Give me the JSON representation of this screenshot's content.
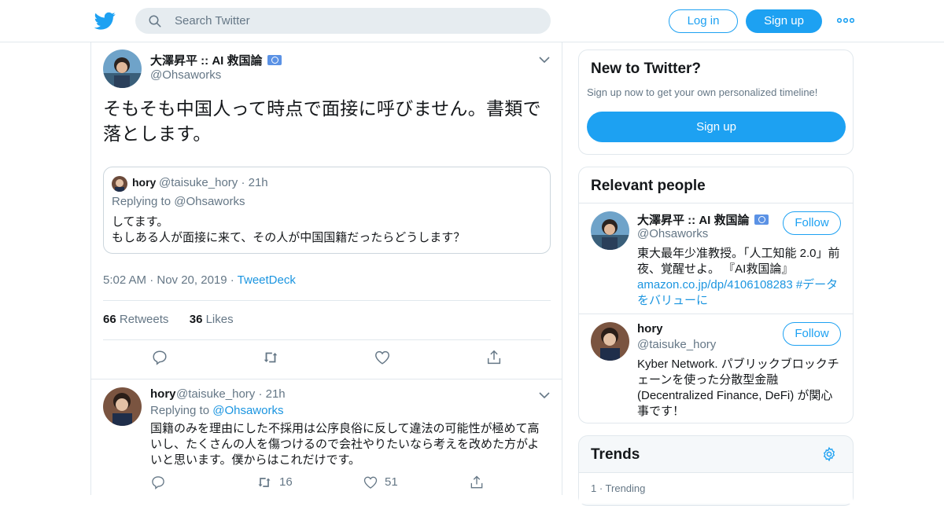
{
  "header": {
    "search_placeholder": "Search Twitter",
    "login_label": "Log in",
    "signup_label": "Sign up"
  },
  "tweet": {
    "author_name": "大澤昇平 :: AI 救国論",
    "author_handle": "@Ohsaworks",
    "text": "そもそも中国人って時点で面接に呼びません。書類で落とします。",
    "quote": {
      "author_name": "hory",
      "author_handle": "@taisuke_hory · 21h",
      "replying_to": "Replying to @Ohsaworks",
      "text_line1": "してます。",
      "text_line2": "もしある人が面接に来て、その人が中国国籍だったらどうします？"
    },
    "time": "5:02 AM · Nov 20, 2019 · ",
    "source": "TweetDeck",
    "retweets_count": "66",
    "retweets_label": "Retweets",
    "likes_count": "36",
    "likes_label": "Likes"
  },
  "reply": {
    "author_name": "hory",
    "author_handle": "@taisuke_hory · 21h",
    "replying_prefix": "Replying to ",
    "replying_handle": "@Ohsaworks",
    "text": "国籍のみを理由にした不採用は公序良俗に反して違法の可能性が極めて高いし、たくさんの人を傷つけるので会社やりたいなら考えを改めた方がよいと思います。僕からはこれだけです。",
    "retweets": "16",
    "likes": "51"
  },
  "sidebar": {
    "new_title": "New to Twitter?",
    "new_sub": "Sign up now to get your own personalized timeline!",
    "new_button": "Sign up",
    "people_title": "Relevant people",
    "people": [
      {
        "name": "大澤昇平 :: AI 救国論",
        "handle": "@Ohsaworks",
        "follow": "Follow",
        "bio_text": "東大最年少准教授。「人工知能 2.0」前夜、覚醒せよ。 『AI救国論』",
        "bio_link": "amazon.co.jp/dp/4106108283 #データをバリューに"
      },
      {
        "name": "hory",
        "handle": "@taisuke_hory",
        "follow": "Follow",
        "bio_text": "Kyber Network. パブリックブロックチェーンを使った分散型金融(Decentralized Finance, DeFi) が関心事です！"
      }
    ],
    "trends_title": "Trends",
    "trend_meta": "1 · Trending"
  },
  "colors": {
    "brand_blue": "#1da1f2",
    "link_blue": "#1b95e0",
    "muted": "#657786",
    "border": "#e1e8ed"
  },
  "icons": [
    "twitter-bird-icon",
    "search-icon",
    "more-dots-icon",
    "chevron-down-icon",
    "reply-icon",
    "retweet-icon",
    "like-icon",
    "share-icon",
    "gear-icon"
  ]
}
